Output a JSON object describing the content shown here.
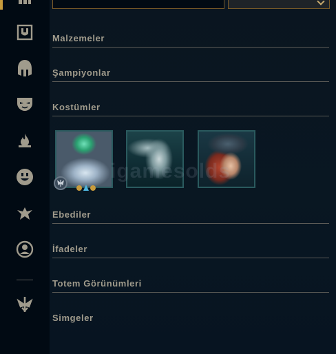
{
  "search": {
    "placeholder": ""
  },
  "filter": {
    "selected": ""
  },
  "sidebar": {
    "items": [
      {
        "name": "collection",
        "icon": "grid-icon"
      },
      {
        "name": "items",
        "icon": "shield-crest-icon"
      },
      {
        "name": "champions",
        "icon": "helmet-icon"
      },
      {
        "name": "skins",
        "icon": "mask-icon"
      },
      {
        "name": "spells",
        "icon": "flame-icon"
      },
      {
        "name": "emotes",
        "icon": "smiley-icon"
      },
      {
        "name": "wards",
        "icon": "winged-icon"
      },
      {
        "name": "icons",
        "icon": "profile-icon"
      },
      {
        "name": "tft",
        "icon": "arrow-crest-icon"
      }
    ]
  },
  "sections": {
    "items": "Malzemeler",
    "champions": "Şampiyonlar",
    "skins": "Kostümler",
    "eternals": "Ebediler",
    "emotes": "İfadeler",
    "ward_skins": "Totem Görünümleri",
    "icons": "Simgeler"
  },
  "skins": {
    "tiles": [
      {
        "art": "turtle-creature-skin-art"
      },
      {
        "art": "armored-warrior-skin-art"
      },
      {
        "art": "red-haired-pirate-skin-art"
      }
    ]
  },
  "watermark": {
    "text": "igamesolds"
  },
  "colors": {
    "background": "#0a1520",
    "gold": "#c89b3c",
    "section_text": "#a09b8c",
    "divider": "#5b5a56",
    "tile_border": "#2a5a5e"
  }
}
